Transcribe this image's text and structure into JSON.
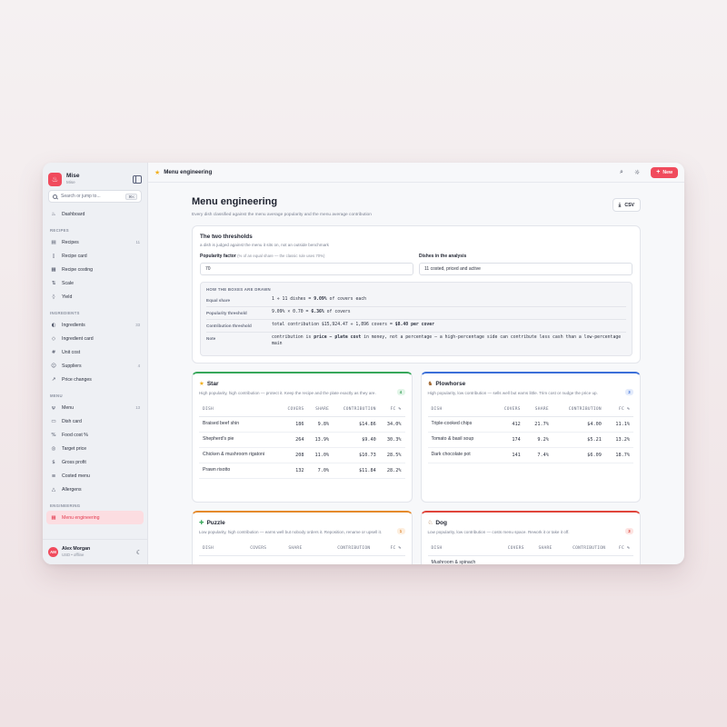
{
  "app": {
    "name": "Mise",
    "workspace": "Mise",
    "brand_color": "#f04b5d"
  },
  "search": {
    "placeholder": "Search or jump to...",
    "shortcut": "⌘K"
  },
  "sidebar": {
    "dashboard": "Dashboard",
    "sections": {
      "recipes": "RECIPES",
      "ingredients": "INGREDIENTS",
      "menu": "MENU",
      "engineering": "ENGINEERING"
    },
    "recipes": [
      {
        "label": "Recipes",
        "count": "11",
        "icon": "book-icon"
      },
      {
        "label": "Recipe card",
        "count": "",
        "icon": "document-icon"
      },
      {
        "label": "Recipe costing",
        "count": "",
        "icon": "calculator-icon"
      },
      {
        "label": "Scale",
        "count": "",
        "icon": "scale-icon"
      },
      {
        "label": "Yield",
        "count": "",
        "icon": "droplet-icon"
      }
    ],
    "ingredients": [
      {
        "label": "Ingredients",
        "count": "33",
        "icon": "apple-icon"
      },
      {
        "label": "Ingredient card",
        "count": "",
        "icon": "tag-icon"
      },
      {
        "label": "Unit cost",
        "count": "",
        "icon": "hash-icon"
      },
      {
        "label": "Suppliers",
        "count": "4",
        "icon": "users-icon"
      },
      {
        "label": "Price changes",
        "count": "",
        "icon": "trend-icon"
      }
    ],
    "menu": [
      {
        "label": "Menu",
        "count": "13",
        "icon": "utensils-icon"
      },
      {
        "label": "Dish card",
        "count": "",
        "icon": "card-icon"
      },
      {
        "label": "Food cost %",
        "count": "",
        "icon": "percent-icon"
      },
      {
        "label": "Target price",
        "count": "",
        "icon": "target-icon"
      },
      {
        "label": "Gross profit",
        "count": "",
        "icon": "dollar-icon"
      },
      {
        "label": "Costed menu",
        "count": "",
        "icon": "list-icon"
      },
      {
        "label": "Allergens",
        "count": "",
        "icon": "warning-icon"
      }
    ],
    "engineering": [
      {
        "label": "Menu engineering",
        "active": true,
        "icon": "grid-icon"
      }
    ],
    "user": {
      "initials": "AM",
      "name": "Alex Morgan",
      "sub": "USD • offline"
    }
  },
  "topbar": {
    "title": "Menu engineering",
    "new_label": "New"
  },
  "page": {
    "title": "Menu engineering",
    "subtitle": "Every dish classified against the menu average popularity and the menu average contribution",
    "csv_label": "CSV"
  },
  "thresholds": {
    "title": "The two thresholds",
    "subtitle": "a dish is judged against the menu it sits on, not an outside benchmark",
    "popularity_label": "Popularity factor",
    "popularity_hint": "(% of an equal share — the classic rule uses 70%)",
    "popularity_value": "70",
    "dishes_label": "Dishes in the analysis",
    "dishes_value": "11 costed, priced and active",
    "how_title": "HOW THE BOXES ARE DRAWN",
    "rows": [
      {
        "k": "Equal share",
        "v1": "1 ÷ 11 dishes = ",
        "b": "9.09%",
        "v2": " of covers each"
      },
      {
        "k": "Popularity threshold",
        "v1": "9.09% × 0.70 = ",
        "b": "6.36%",
        "v2": " of covers"
      },
      {
        "k": "Contribution threshold",
        "v1": "total contribution $15,924.47 ÷ 1,896 covers = ",
        "b": "$8.40 per cover",
        "v2": ""
      },
      {
        "k": "Note",
        "v1": "contribution is ",
        "b": "price − plate cost",
        "v2": " in money, not a percentage — a high-percentage side can contribute less cash than a low-percentage main"
      }
    ]
  },
  "columns": [
    "DISH",
    "COVERS",
    "SHARE",
    "CONTRIBUTION",
    "FC %"
  ],
  "quadrants": {
    "star": {
      "title": "Star",
      "count": "4",
      "desc": "High popularity, high contribution — protect it. Keep the recipe and the plate exactly as they are.",
      "rows": [
        [
          "Braised beef shin",
          "186",
          "9.8%",
          "$14.86",
          "34.0%"
        ],
        [
          "Shepherd's pie",
          "264",
          "13.9%",
          "$9.40",
          "30.3%"
        ],
        [
          "Chicken & mushroom rigatoni",
          "208",
          "11.0%",
          "$10.73",
          "28.5%"
        ],
        [
          "Prawn risotto",
          "132",
          "7.0%",
          "$11.84",
          "28.2%"
        ]
      ]
    },
    "plowhorse": {
      "title": "Plowhorse",
      "count": "3",
      "desc": "High popularity, low contribution — sells well but earns little. Trim cost or nudge the price up.",
      "rows": [
        [
          "Triple-cooked chips",
          "412",
          "21.7%",
          "$4.00",
          "11.1%"
        ],
        [
          "Tomato & basil soup",
          "174",
          "9.2%",
          "$5.21",
          "13.2%"
        ],
        [
          "Dark chocolate pot",
          "141",
          "7.4%",
          "$6.09",
          "18.7%"
        ]
      ]
    },
    "puzzle": {
      "title": "Puzzle",
      "count": "1",
      "desc": "Low popularity, high contribution — earns well but nobody orders it. Reposition, rename or upsell it.",
      "rows": []
    },
    "dog": {
      "title": "Dog",
      "count": "3",
      "desc": "Low popularity, low contribution — costs menu space. Rework it or take it off.",
      "rows": [
        [
          "Mushroom & spinach",
          "",
          "",
          "",
          ""
        ]
      ]
    }
  }
}
